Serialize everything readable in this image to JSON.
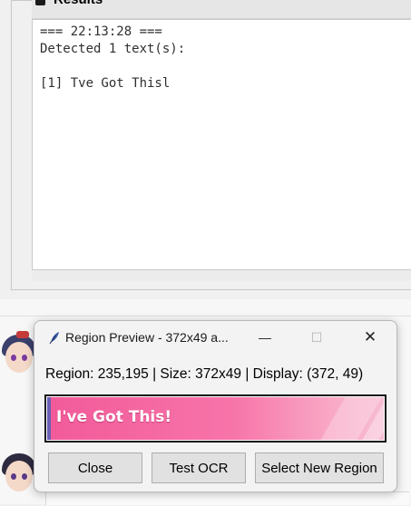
{
  "results": {
    "title": "Results",
    "lines": [
      "=== 22:13:28 ===",
      "Detected 1 text(s):",
      "",
      "[1] Tve Got Thisl"
    ]
  },
  "dialog": {
    "title": "Region Preview - 372x49 a...",
    "info": "Region: 235,195 | Size: 372x49 | Display: (372, 49)",
    "preview_text": "I've Got This!",
    "buttons": {
      "close": "Close",
      "test_ocr": "Test OCR",
      "select_new": "Select New Region"
    },
    "window_controls": {
      "minimize": "—",
      "maximize": "☐",
      "close": "✕"
    }
  },
  "icons": {
    "results": "pin-icon",
    "dialog": "feather-icon"
  },
  "colors": {
    "preview_pink": "#f25a99",
    "dialog_bg": "#f3f3f3",
    "button_bg": "#e1e1e1"
  }
}
